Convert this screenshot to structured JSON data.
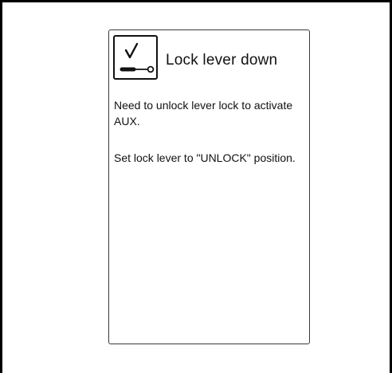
{
  "dialog": {
    "icon": "lock-lever-down-icon",
    "title": "Lock lever down",
    "messages": [
      "Need to unlock lever lock to activate AUX.",
      "Set lock lever to \"UNLOCK\" position."
    ]
  }
}
